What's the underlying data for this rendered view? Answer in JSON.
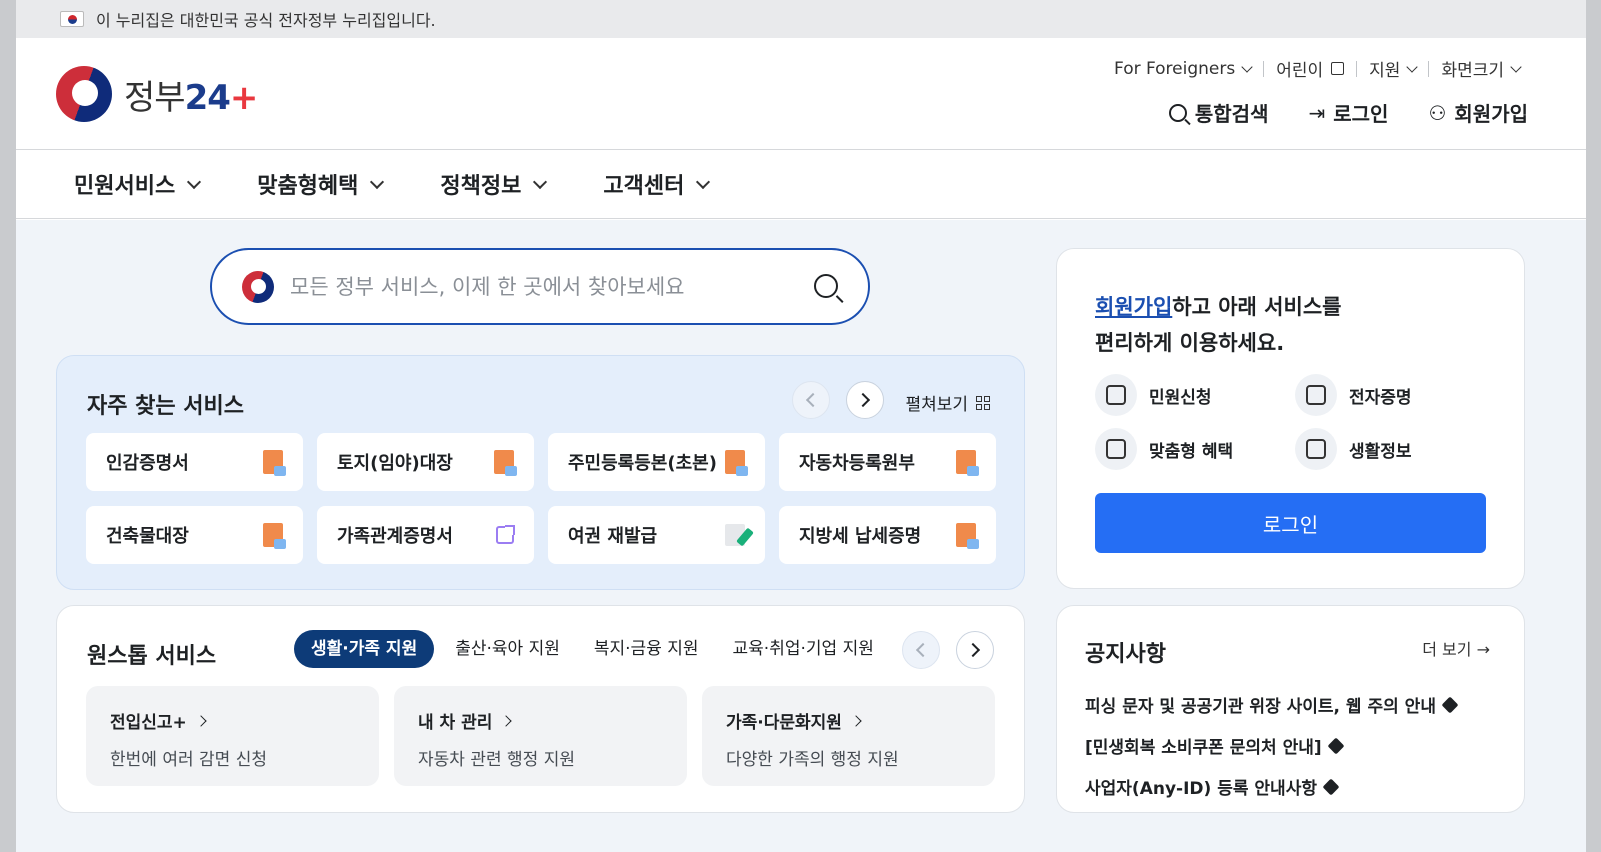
{
  "banner": {
    "text": "이 누리집은 대한민국 공식 전자정부 누리집입니다."
  },
  "logo": {
    "text": "정부",
    "num": "24",
    "plus": "+"
  },
  "util": [
    {
      "label": "For Foreigners"
    },
    {
      "label": "어린이"
    },
    {
      "label": "지원"
    },
    {
      "label": "화면크기"
    }
  ],
  "actions": {
    "search": "통합검색",
    "login": "로그인",
    "join": "회원가입"
  },
  "gnb": [
    "민원서비스",
    "맞춤형혜택",
    "정책정보",
    "고객센터"
  ],
  "search": {
    "placeholder": "모든 정부 서비스, 이제 한 곳에서 찾아보세요"
  },
  "favorites": {
    "title": "자주 찾는 서비스",
    "expand": "펼쳐보기",
    "items": [
      {
        "label": "인감증명서",
        "icon": "pdf-icon"
      },
      {
        "label": "토지(임야)대장",
        "icon": "pdf-icon"
      },
      {
        "label": "주민등록등본(초본)",
        "icon": "pdf-icon"
      },
      {
        "label": "자동차등록원부",
        "icon": "pdf-icon"
      },
      {
        "label": "건축물대장",
        "icon": "pdf-icon"
      },
      {
        "label": "가족관계증명서",
        "icon": "external-link-icon"
      },
      {
        "label": "여권 재발급",
        "icon": "edit-icon"
      },
      {
        "label": "지방세 납세증명",
        "icon": "pdf-icon"
      }
    ]
  },
  "onestop": {
    "title": "원스톱 서비스",
    "tabs": [
      "생활·가족 지원",
      "출산·육아 지원",
      "복지·금융 지원",
      "교육·취업·기업 지원"
    ],
    "cards": [
      {
        "title": "전입신고+",
        "desc": "한번에 여러 감면 신청"
      },
      {
        "title": "내 차 관리",
        "desc": "자동차 관련 행정 지원"
      },
      {
        "title": "가족·다문화지원",
        "desc": "다양한 가족의 행정 지원"
      }
    ]
  },
  "member": {
    "link": "회원가입",
    "line1_rest": "하고 아래 서비스를",
    "line2": "편리하게 이용하세요.",
    "items": [
      "민원신청",
      "전자증명",
      "맞춤형 혜택",
      "생활정보"
    ],
    "login_button": "로그인"
  },
  "notice": {
    "title": "공지사항",
    "more": "더 보기 →",
    "items": [
      "피싱 문자 및 공공기관 위장 사이트, 웹 주의 안내",
      "[민생회복 소비쿠폰 문의처 안내]",
      "사업자(Any-ID) 등록 안내사항"
    ]
  },
  "colors": {
    "primary": "#256ef4",
    "navy": "#0d3b78",
    "link": "#1b4fb1",
    "fav_bg": "#e4eefb"
  }
}
